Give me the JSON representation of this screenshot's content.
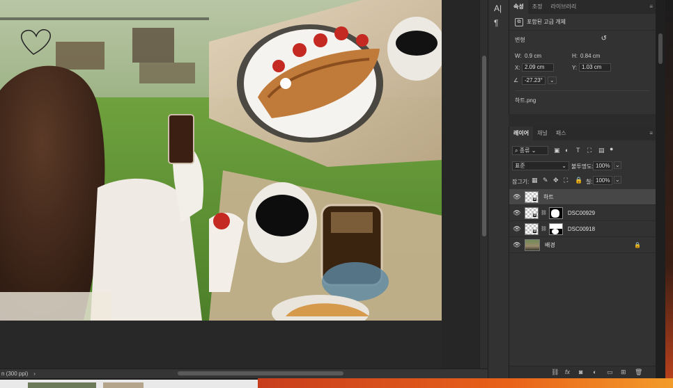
{
  "status": {
    "zoom_text": "n (300 ppi)",
    "chevron": "›"
  },
  "toolstrip": {
    "char_icon": "A|",
    "para_icon": "¶"
  },
  "properties": {
    "tabs": [
      "속성",
      "조정",
      "라이브러리"
    ],
    "object_type": "포함된 고급 개체",
    "section": "변형",
    "w_label": "W:",
    "w_value": "0.9 cm",
    "h_label": "H:",
    "h_value": "0.84 cm",
    "x_label": "X:",
    "x_value": "2.09 cm",
    "y_label": "Y:",
    "y_value": "1.03 cm",
    "angle_value": "-27.23°",
    "filename": "하트.png"
  },
  "layers": {
    "tabs": [
      "레이어",
      "채널",
      "패스"
    ],
    "filter_label": "종류",
    "blend_mode": "표준",
    "opacity_label": "불투명도:",
    "opacity_value": "100%",
    "lock_label": "잠그기:",
    "fill_label": "칠:",
    "fill_value": "100%",
    "items": [
      {
        "name": "하트",
        "selected": true,
        "mask": false
      },
      {
        "name": "DSC00929",
        "selected": false,
        "mask": true
      },
      {
        "name": "DSC00918",
        "selected": false,
        "mask": true
      },
      {
        "name": "배경",
        "selected": false,
        "mask": false,
        "locked": true
      }
    ],
    "footer_icons": [
      "link-icon",
      "fx-icon",
      "mask-icon",
      "adjustment-icon",
      "folder-icon",
      "new-layer-icon",
      "trash-icon"
    ]
  },
  "colors": {
    "panel": "#323232",
    "selected_layer": "#474747",
    "dock_orange": "#e8621a"
  }
}
